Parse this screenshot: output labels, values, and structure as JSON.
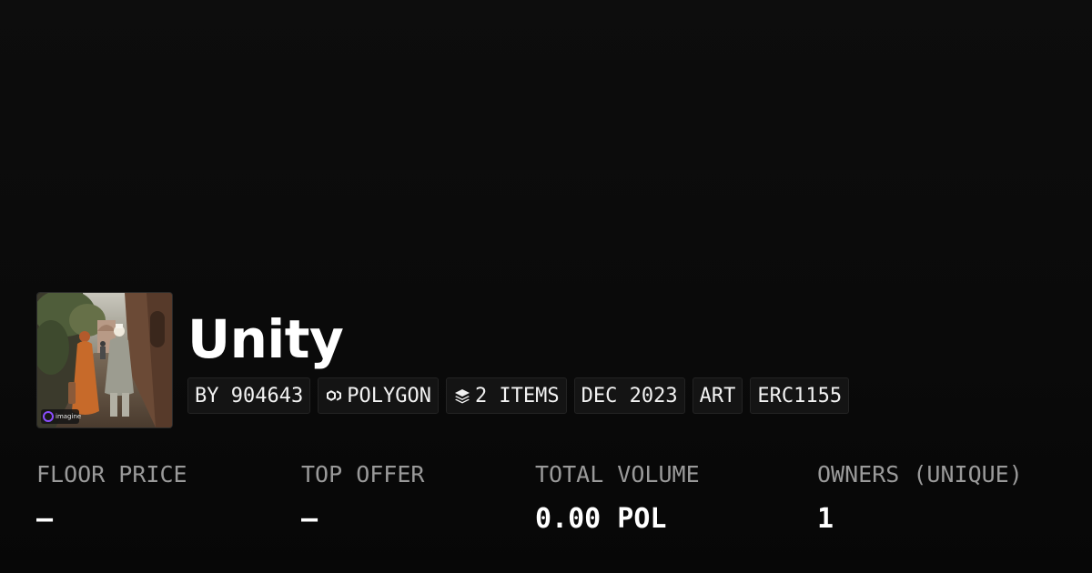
{
  "collection": {
    "title": "Unity",
    "thumbnail_icon": "collection-art-thumbnail",
    "watermark_text": "imagine"
  },
  "chips": [
    {
      "label": "BY 904643",
      "icon": null
    },
    {
      "label": "POLYGON",
      "icon": "polygon-chain-icon"
    },
    {
      "label": "2 ITEMS",
      "icon": "layers-icon"
    },
    {
      "label": "DEC 2023",
      "icon": null
    },
    {
      "label": "ART",
      "icon": null
    },
    {
      "label": "ERC1155",
      "icon": null
    }
  ],
  "stats": [
    {
      "label": "FLOOR PRICE",
      "value": "–"
    },
    {
      "label": "TOP OFFER",
      "value": "–"
    },
    {
      "label": "TOTAL VOLUME",
      "value": "0.00 POL"
    },
    {
      "label": "OWNERS (UNIQUE)",
      "value": "1"
    }
  ],
  "colors": {
    "background": "#0b0b0b",
    "text_primary": "#ffffff",
    "text_muted": "#9a9a9a",
    "chip_background": "#141414"
  }
}
